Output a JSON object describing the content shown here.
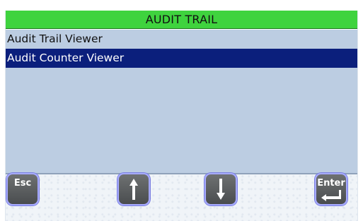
{
  "title": "AUDIT TRAIL",
  "menu": {
    "items": [
      {
        "label": "Audit Trail Viewer",
        "selected": false
      },
      {
        "label": "Audit Counter Viewer",
        "selected": true
      }
    ]
  },
  "buttons": {
    "esc_label": "Esc",
    "up_icon": "arrow-up-icon",
    "down_icon": "arrow-down-icon",
    "enter_label": "Enter",
    "enter_icon": "enter-return-icon"
  },
  "colors": {
    "title_bg": "#3fd33e",
    "list_bg": "#bccde2",
    "selected_bg": "#0b1f7c",
    "button_border": "#a6aaff"
  }
}
